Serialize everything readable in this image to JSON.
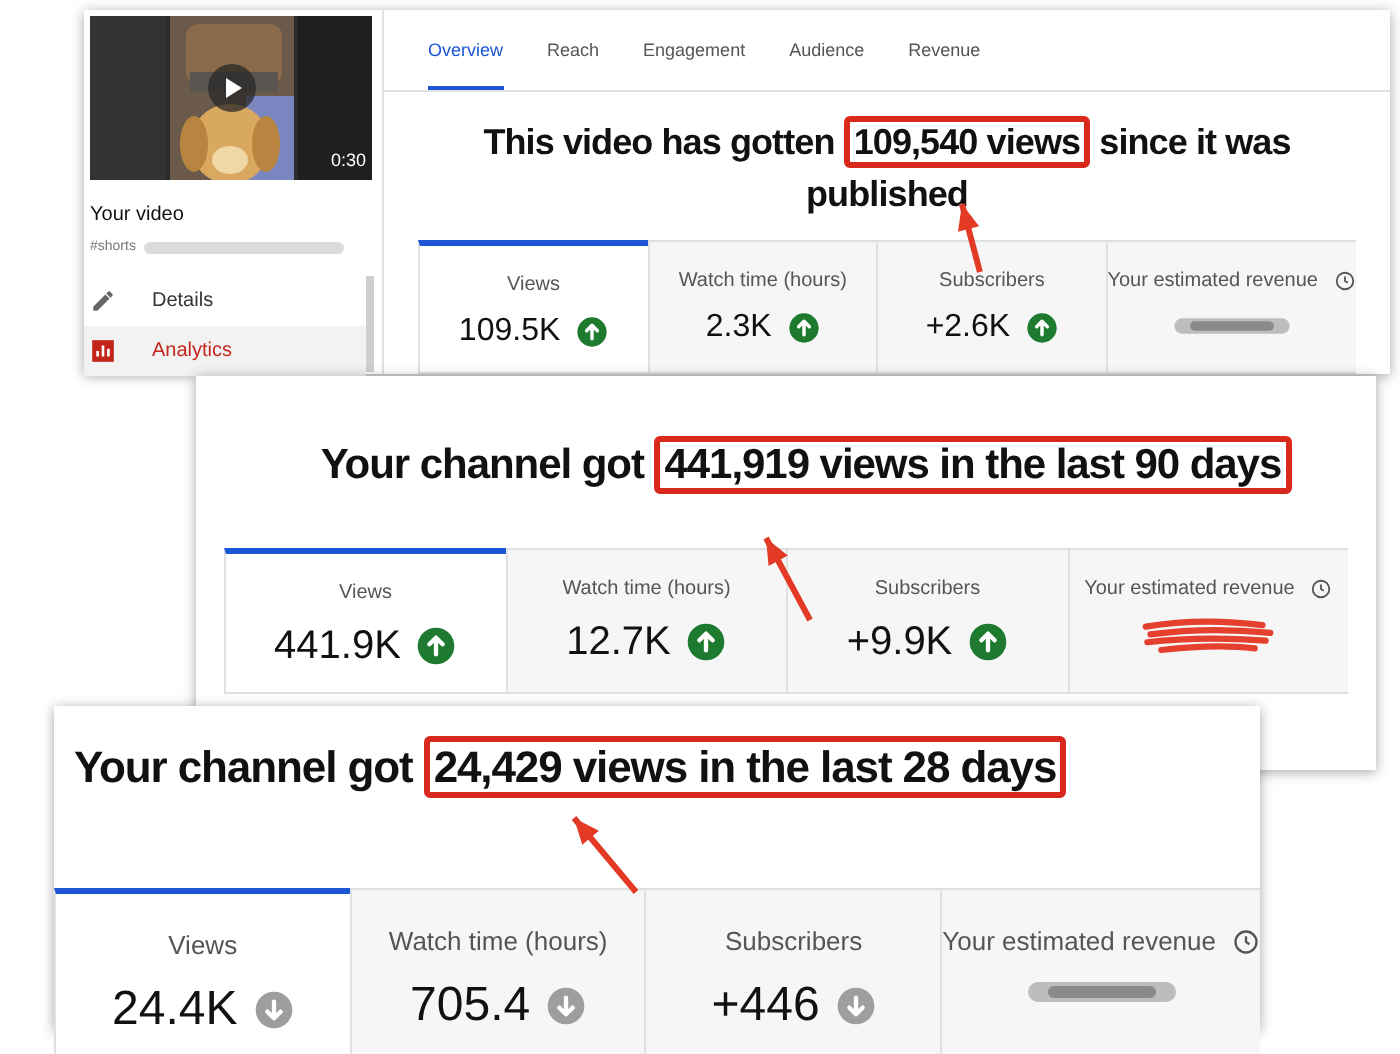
{
  "video_panel": {
    "duration": "0:30",
    "sidebar_title": "Your video",
    "sidebar_subtitle": "#shorts",
    "nav": [
      {
        "label": "Details",
        "kind": "pencil",
        "selected": false
      },
      {
        "label": "Analytics",
        "kind": "chart",
        "selected": true
      }
    ],
    "tabs": [
      {
        "label": "Overview",
        "selected": true
      },
      {
        "label": "Reach",
        "selected": false
      },
      {
        "label": "Engagement",
        "selected": false
      },
      {
        "label": "Audience",
        "selected": false
      },
      {
        "label": "Revenue",
        "selected": false
      }
    ],
    "headline": {
      "before": "This video has gotten",
      "highlight": "109,540 views",
      "after": "since it was published"
    },
    "metrics": [
      {
        "label": "Views",
        "value": "109.5K",
        "rising": true,
        "selected": true
      },
      {
        "label": "Watch time (hours)",
        "value": "2.3K",
        "rising": true,
        "selected": false
      },
      {
        "label": "Subscribers",
        "value": "+2.6K",
        "rising": true,
        "selected": false
      },
      {
        "label": "Your estimated revenue",
        "kind": "blurred",
        "selected": false
      }
    ]
  },
  "channel_90_panel": {
    "headline": {
      "before": "Your channel got",
      "highlight": "441,919 views in the last 90 days"
    },
    "metrics": [
      {
        "label": "Views",
        "value": "441.9K",
        "rising": true,
        "selected": true
      },
      {
        "label": "Watch time (hours)",
        "value": "12.7K",
        "rising": true,
        "selected": false
      },
      {
        "label": "Subscribers",
        "value": "+9.9K",
        "rising": true,
        "selected": false
      },
      {
        "label": "Your estimated revenue",
        "kind": "scribbled",
        "selected": false
      }
    ]
  },
  "channel_28_panel": {
    "headline": {
      "before": "Your channel got",
      "highlight": "24,429 views in the last 28 days"
    },
    "metrics": [
      {
        "label": "Views",
        "value": "24.4K",
        "rising": false,
        "selected": true
      },
      {
        "label": "Watch time (hours)",
        "value": "705.4",
        "rising": false,
        "selected": false
      },
      {
        "label": "Subscribers",
        "value": "+446",
        "rising": false,
        "selected": false
      },
      {
        "label": "Your estimated revenue",
        "kind": "blurred",
        "selected": false
      }
    ]
  }
}
